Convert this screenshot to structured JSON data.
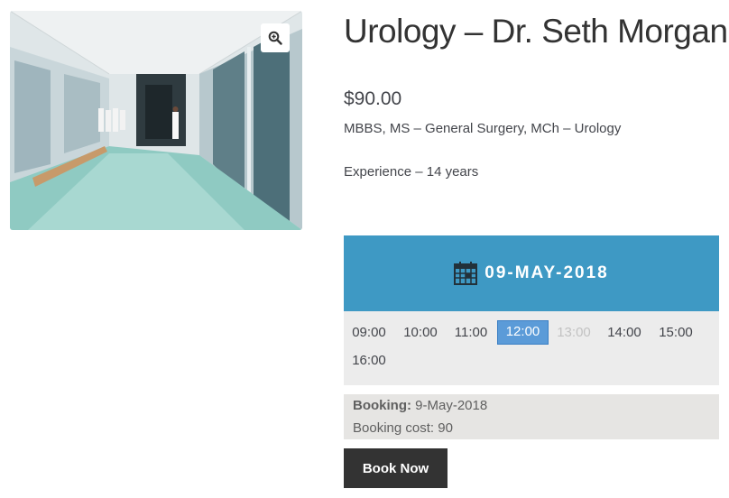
{
  "product": {
    "title": "Urology – Dr. Seth Morgan",
    "price": "$90.00",
    "qualifications": "MBBS,  MS – General Surgery, MCh – Urology",
    "experience": "Experience – 14 years",
    "image_icon": "zoom-in-icon"
  },
  "calendar": {
    "icon": "calendar-icon",
    "date": "09-MAY-2018",
    "header_color": "#3e99c4",
    "slots": [
      {
        "time": "09:00",
        "state": "available"
      },
      {
        "time": "10:00",
        "state": "available"
      },
      {
        "time": "11:00",
        "state": "available"
      },
      {
        "time": "12:00",
        "state": "selected"
      },
      {
        "time": "13:00",
        "state": "disabled"
      },
      {
        "time": "14:00",
        "state": "available"
      },
      {
        "time": "15:00",
        "state": "available"
      },
      {
        "time": "16:00",
        "state": "available"
      }
    ]
  },
  "summary": {
    "booking_label": "Booking:",
    "booking_value": " 9-May-2018",
    "cost_label": "Booking cost:",
    "cost_value": " 90"
  },
  "actions": {
    "book_now_label": "Book Now"
  }
}
